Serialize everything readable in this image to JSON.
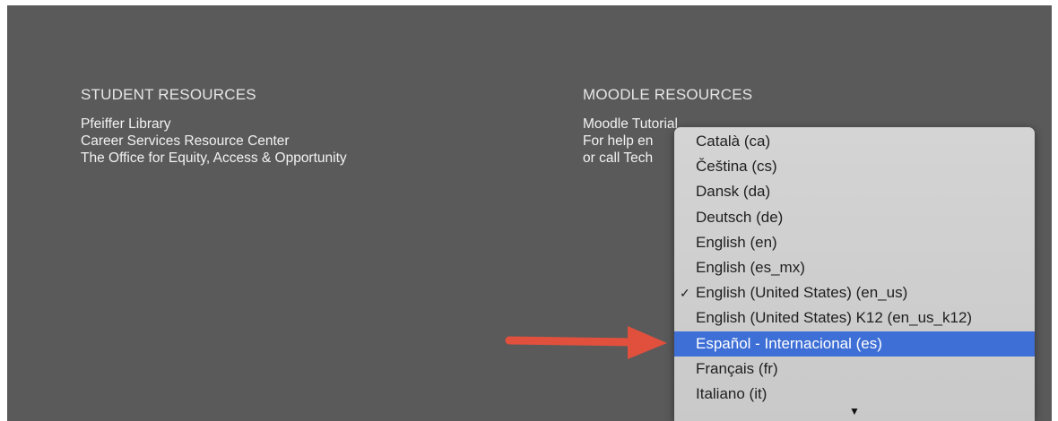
{
  "student_resources": {
    "title": "STUDENT RESOURCES",
    "links": [
      "Pfeiffer Library",
      "Career Services Resource Center",
      "The Office for Equity, Access & Opportunity"
    ]
  },
  "moodle_resources": {
    "title": "MOODLE RESOURCES",
    "links": [
      "Moodle Tutorial",
      "For help en",
      "or call Tech"
    ]
  },
  "language_dropdown": {
    "options": [
      "Català (ca)",
      "Čeština (cs)",
      "Dansk (da)",
      "Deutsch (de)",
      "English (en)",
      "English (es_mx)",
      "English (United States) (en_us)",
      "English (United States) K12 (en_us_k12)",
      "Español - Internacional (es)",
      "Français (fr)",
      "Italiano (it)"
    ],
    "checked_option": "English (United States) (en_us)",
    "highlighted_option": "Español - Internacional (es)",
    "checkmark": "✓",
    "scroll_indicator": "▼"
  },
  "colors": {
    "footer_bg": "#5a5a5a",
    "highlight": "#3e6fd6",
    "arrow": "#e0503d"
  },
  "icons": [
    "checkmark-icon",
    "scroll-down-arrow-icon",
    "annotation-arrow"
  ]
}
